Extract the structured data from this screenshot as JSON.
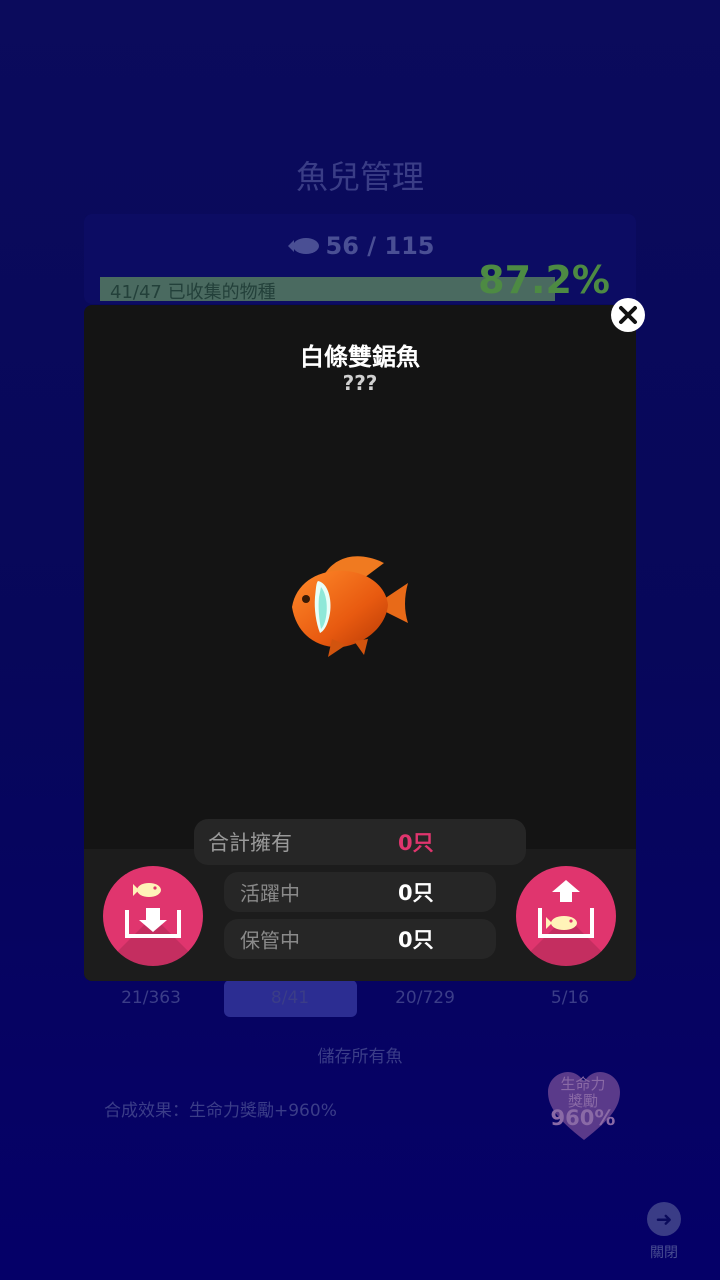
{
  "background": {
    "title": "魚兒管理",
    "fish_count": "56 / 115",
    "collected_text": "41/47 已收集的物種",
    "percent": "87.2%",
    "tab_values": [
      "21/363",
      "8/41",
      "20/729",
      "5/16"
    ],
    "save_all_label": "儲存所有魚",
    "synthesis_effect": "合成效果：生命力獎勵+960%",
    "heart_label": "生命力\n獎勵",
    "heart_percent": "960%",
    "close_label": "關閉"
  },
  "modal": {
    "fish_name": "白條雙鋸魚",
    "fish_subtitle": "???",
    "stats": {
      "total_label": "合計擁有",
      "total_value": "0只",
      "active_label": "活躍中",
      "active_value": "0只",
      "stored_label": "保管中",
      "stored_value": "0只"
    }
  },
  "colors": {
    "accent_pink": "#e0356e",
    "modal_bg": "#141414",
    "page_bg": "#0b0b5c",
    "percent_green": "#4d8a43"
  },
  "icons": {
    "store_button": "fish-down-into-box-icon",
    "release_button": "fish-up-out-of-box-icon",
    "close": "close-icon"
  }
}
